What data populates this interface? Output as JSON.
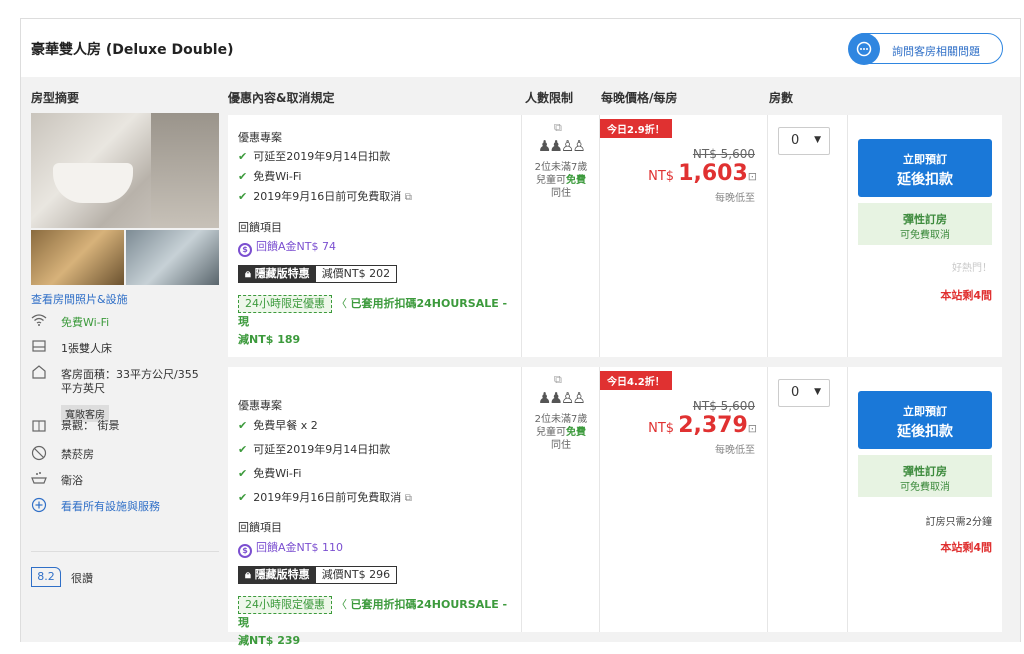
{
  "room": {
    "title": "豪華雙人房 (Deluxe Double)",
    "ask_button": "詢問客房相關問題"
  },
  "headers": {
    "summary": "房型摘要",
    "deal": "優惠內容&取消規定",
    "occupancy": "人數限制",
    "price": "每晚價格/每房",
    "rooms": "房數"
  },
  "summary": {
    "photo_link": "查看房間照片&設施",
    "features": [
      {
        "icon": "wifi-icon",
        "text": "免費Wi-Fi"
      },
      {
        "icon": "bed-icon",
        "text": "1張雙人床"
      },
      {
        "icon": "house-icon",
        "text": "客房面積：33平方公尺/355"
      },
      {
        "icon": "",
        "text": "平方英尺"
      },
      {
        "icon": "window-icon",
        "text": "景觀： 街景"
      },
      {
        "icon": "no-smoking-icon",
        "text": "禁菸房"
      },
      {
        "icon": "bath-icon",
        "text": "衛浴"
      },
      {
        "icon": "plus-circle-icon",
        "text": "看看所有設施與服務"
      }
    ],
    "badge": "寬敞客房",
    "score": "8.2",
    "score_word": "很讚"
  },
  "offers": [
    {
      "deal_title": "優惠專案",
      "benefits": [
        "可延至2019年9月14日扣款",
        "免費Wi-Fi",
        "2019年9月16日前可免費取消"
      ],
      "reward_title": "回饋項目",
      "reward": "回饋A金NT$ 74",
      "secret_label": "隱藏版特惠",
      "secret_value": "減價NT$ 202",
      "promo_tag": "24小時限定優惠",
      "promo_text": "已套用折扣碼24HOURSALE - 現",
      "promo_text2": "減NT$ 189",
      "occupancy_text1": "2位未滿7歲",
      "occupancy_text2": "兒童可",
      "occupancy_free": "免費",
      "occupancy_text3": "同住",
      "discount": "今日2.9折！",
      "old_price": "NT$ 5,600",
      "currency": "NT$ ",
      "price": "1,603",
      "price_unit": "每晚低至",
      "qty": "0",
      "book_l1": "立即預訂",
      "book_l2": "延後扣款",
      "flex_l1": "彈性訂房",
      "flex_l2": "可免費取消",
      "extra": "好熱門！",
      "rooms_left": "本站剩4間"
    },
    {
      "deal_title": "優惠專案",
      "benefits": [
        "免費早餐 x 2",
        "可延至2019年9月14日扣款",
        "免費Wi-Fi",
        "2019年9月16日前可免費取消"
      ],
      "reward_title": "回饋項目",
      "reward": "回饋A金NT$ 110",
      "secret_label": "隱藏版特惠",
      "secret_value": "減價NT$ 296",
      "promo_tag": "24小時限定優惠",
      "promo_text": "已套用折扣碼24HOURSALE - 現",
      "promo_text2": "減NT$ 239",
      "occupancy_text1": "2位未滿7歲",
      "occupancy_text2": "兒童可",
      "occupancy_free": "免費",
      "occupancy_text3": "同住",
      "discount": "今日4.2折！",
      "old_price": "NT$ 5,600",
      "currency": "NT$ ",
      "price": "2,379",
      "price_unit": "每晚低至",
      "qty": "0",
      "book_l1": "立即預訂",
      "book_l2": "延後扣款",
      "flex_l1": "彈性訂房",
      "flex_l2": "可免費取消",
      "extra": "訂房只需2分鐘",
      "rooms_left": "本站剩4間"
    }
  ]
}
